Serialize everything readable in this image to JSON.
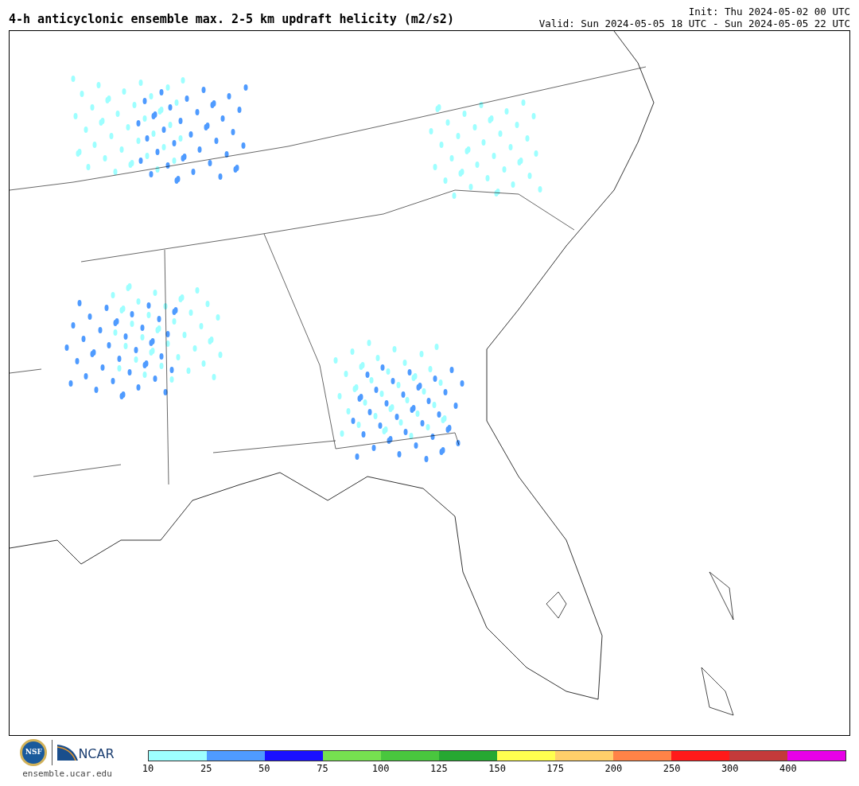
{
  "title": "4-h anticyclonic ensemble max. 2-5 km updraft helicity (m2/s2)",
  "init": "Init: Thu 2024-05-02 00 UTC",
  "valid": "Valid: Sun 2024-05-05 18 UTC - Sun 2024-05-05 22 UTC",
  "logos": {
    "nsf": "NSF",
    "ncar": "NCAR",
    "url": "ensemble.ucar.edu"
  },
  "colorbar": [
    {
      "label": "10",
      "color": "#9effff"
    },
    {
      "label": "25",
      "color": "#4f9bff"
    },
    {
      "label": "50",
      "color": "#1a10ff"
    },
    {
      "label": "75",
      "color": "#76e050"
    },
    {
      "label": "100",
      "color": "#49c63e"
    },
    {
      "label": "125",
      "color": "#26a832"
    },
    {
      "label": "150",
      "color": "#ffff4f"
    },
    {
      "label": "175",
      "color": "#ffcf6a"
    },
    {
      "label": "200",
      "color": "#ff8347"
    },
    {
      "label": "250",
      "color": "#ff1a1a"
    },
    {
      "label": "300",
      "color": "#c43a3a"
    },
    {
      "label": "400",
      "color": "#e800e8"
    }
  ]
}
